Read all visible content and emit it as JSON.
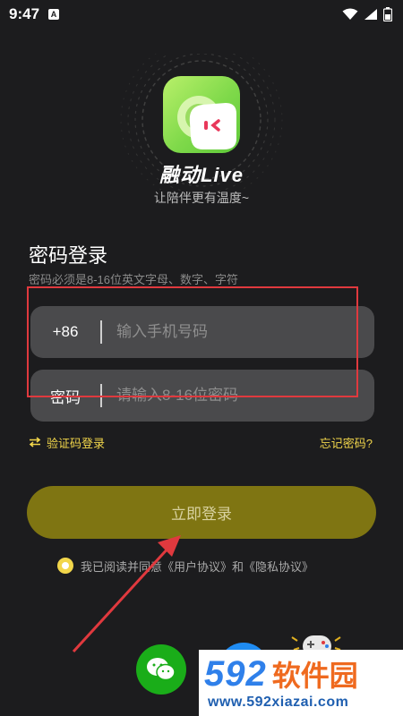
{
  "status_bar": {
    "time": "9:47",
    "notification_glyph": "A"
  },
  "app": {
    "name": "融动Live",
    "slogan": "让陪伴更有温度~"
  },
  "login": {
    "title": "密码登录",
    "hint": "密码必须是8-16位英文字母、数字、字符",
    "phone": {
      "prefix": "+86",
      "placeholder": "输入手机号码",
      "value": ""
    },
    "password": {
      "label": "密码",
      "placeholder": "请输入8-16位密码",
      "value": ""
    },
    "switch_label": "验证码登录",
    "forgot_label": "忘记密码?",
    "submit_label": "立即登录",
    "agreement": "我已阅读并同意《用户协议》和《隐私协议》",
    "agreement_checked": true
  },
  "social": [
    "wechat-icon",
    "other-login-icon"
  ],
  "watermark": {
    "brand_number": "592",
    "brand_text": "软件园",
    "url": "www.592xiazai.com"
  },
  "colors": {
    "background": "#1c1c1e",
    "input_bg": "#4a4a4c",
    "accent_yellow": "#f2d64b",
    "button_bg": "#7f7512",
    "annotation_red": "#e0393e",
    "wechat_green": "#1aad19"
  }
}
